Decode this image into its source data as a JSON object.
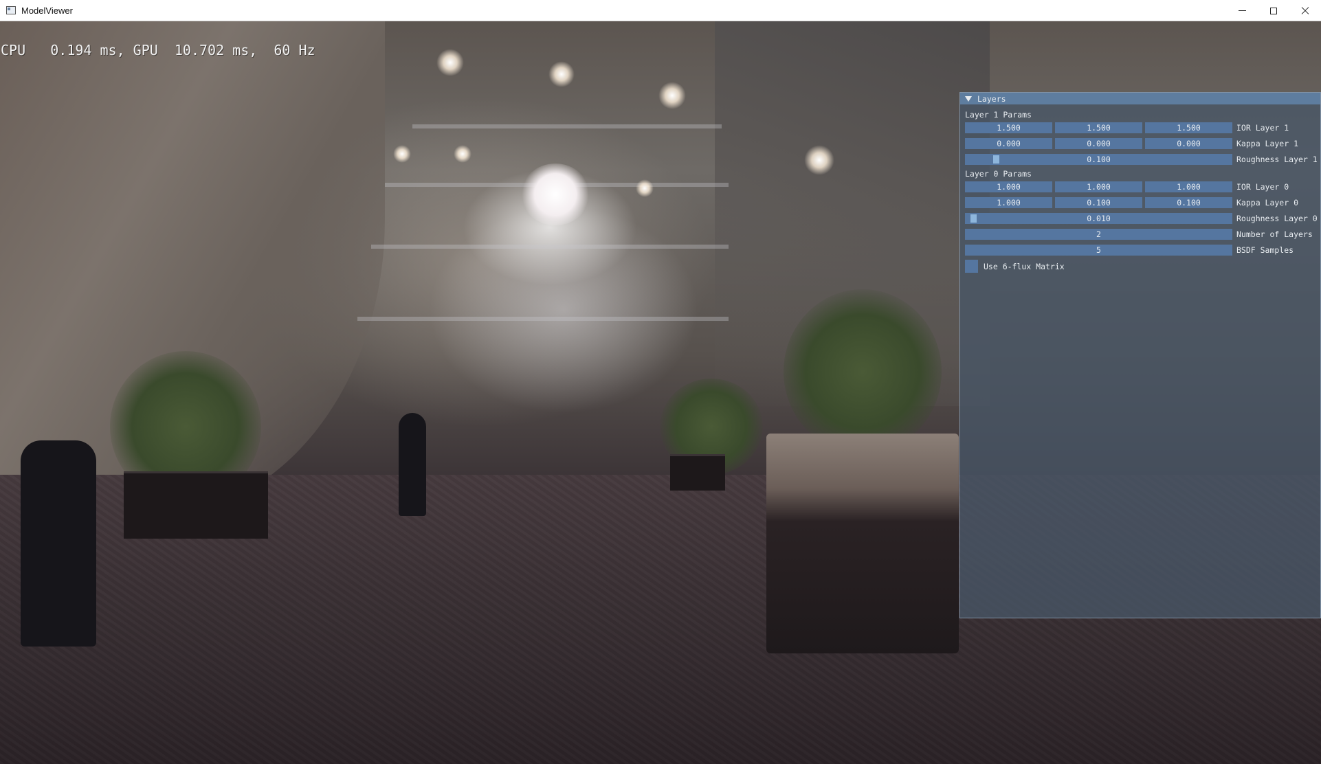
{
  "window": {
    "title": "ModelViewer",
    "controls": [
      "minimize",
      "maximize",
      "close"
    ]
  },
  "perf": {
    "text": "CPU   0.194 ms, GPU  10.702 ms,  60 Hz"
  },
  "panel": {
    "title": "Layers",
    "layer1": {
      "section": "Layer 1 Params",
      "ior": {
        "values": [
          "1.500",
          "1.500",
          "1.500"
        ],
        "label": "IOR Layer 1"
      },
      "kappa": {
        "values": [
          "0.000",
          "0.000",
          "0.000"
        ],
        "label": "Kappa Layer 1"
      },
      "roughness": {
        "value": "0.100",
        "label": "Roughness Layer 1",
        "level": 0.1
      }
    },
    "layer0": {
      "section": "Layer 0 Params",
      "ior": {
        "values": [
          "1.000",
          "1.000",
          "1.000"
        ],
        "label": "IOR Layer 0"
      },
      "kappa": {
        "values": [
          "1.000",
          "0.100",
          "0.100"
        ],
        "label": "Kappa Layer 0"
      },
      "roughness": {
        "value": "0.010",
        "label": "Roughness Layer 0",
        "level": 0.01
      }
    },
    "num_layers": {
      "value": "2",
      "label": "Number of Layers"
    },
    "bsdf_samples": {
      "value": "5",
      "label": "BSDF Samples"
    },
    "six_flux": {
      "label": "Use 6-flux Matrix",
      "checked": false
    }
  },
  "colors": {
    "panel_bg": "#48566699",
    "header": "#5e7d9f",
    "field": "#5576a0",
    "grab": "#8eb6dc"
  }
}
